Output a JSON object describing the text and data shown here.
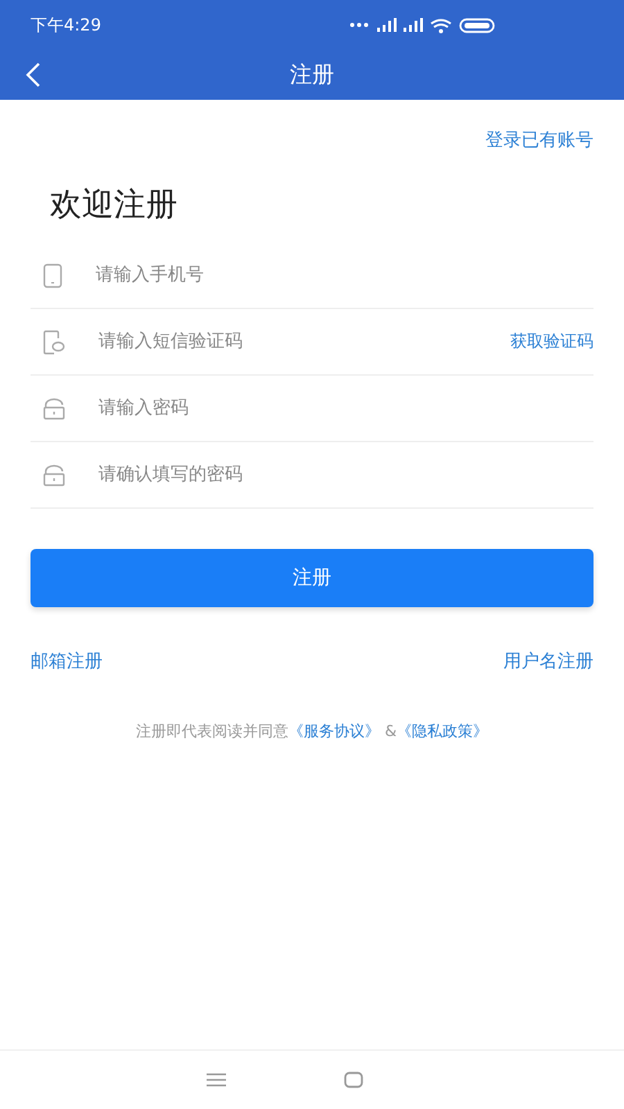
{
  "status_bar": {
    "time": "下午4:29"
  },
  "header": {
    "title": "注册"
  },
  "login_link": "登录已有账号",
  "heading": "欢迎注册",
  "fields": [
    {
      "kind": "phone",
      "placeholder": "请输入手机号"
    },
    {
      "kind": "sms",
      "placeholder": "请输入短信验证码",
      "action": "获取验证码"
    },
    {
      "kind": "lock",
      "placeholder": "请输入密码"
    },
    {
      "kind": "lock",
      "placeholder": "请确认填写的密码"
    }
  ],
  "submit_button": "注册",
  "alt_links": [
    "邮箱注册",
    "用户名注册"
  ],
  "agreement": {
    "prefix": "注册即代表阅读并同意",
    "terms": "《服务协议》",
    "joiner": " &",
    "privacy": "《隐私政策》"
  }
}
